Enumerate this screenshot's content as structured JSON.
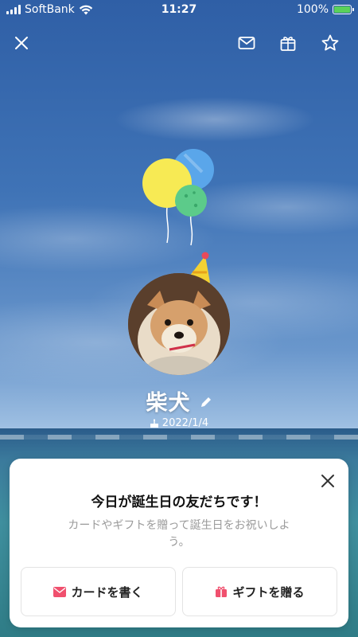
{
  "status_bar": {
    "carrier": "SoftBank",
    "time": "11:27",
    "battery": "100%"
  },
  "profile": {
    "name": "柴犬",
    "birthday": "2022/1/4"
  },
  "card": {
    "title": "今日が誕生日の友だちです！",
    "description": "カードやギフトを贈って誕生日をお祝いしよう。",
    "card_button": "カードを書く",
    "gift_button": "ギフトを贈る"
  },
  "colors": {
    "accent_pink": "#f0506e",
    "balloon_yellow": "#f7ea54",
    "balloon_blue": "#5aa6ea",
    "balloon_green": "#5ccb8a"
  },
  "icons": {
    "close": "close-icon",
    "mail": "mail-icon",
    "gift": "gift-icon",
    "star": "star-icon",
    "pencil": "pencil-icon",
    "cake": "cake-icon"
  }
}
